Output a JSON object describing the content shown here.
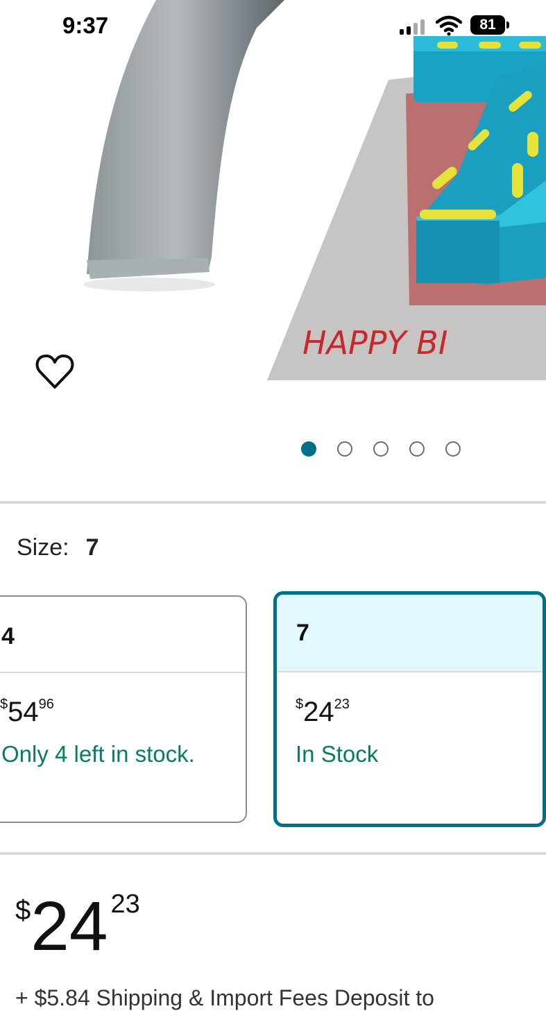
{
  "status_bar": {
    "time": "9:37",
    "battery": "81"
  },
  "product_image": {
    "cake_text": "HAPPY BI"
  },
  "carousel": {
    "total": 5,
    "active_index": 0,
    "active_color": "#007185"
  },
  "size_selector": {
    "label": "Size:",
    "selected": "7",
    "options": [
      {
        "size": "4",
        "price_dollar": "$",
        "price_whole": "54",
        "price_fraction": "96",
        "availability": "Only 4 left in stock."
      },
      {
        "size": "7",
        "price_dollar": "$",
        "price_whole": "24",
        "price_fraction": "23",
        "availability": "In Stock"
      }
    ]
  },
  "price": {
    "currency": "$",
    "whole": "24",
    "fraction": "23"
  },
  "shipping": {
    "text": "+ $5.84 Shipping & Import Fees Deposit to"
  },
  "colors": {
    "accent": "#007185",
    "in_stock": "#067D62",
    "selected_bg": "#E3F8FC"
  }
}
